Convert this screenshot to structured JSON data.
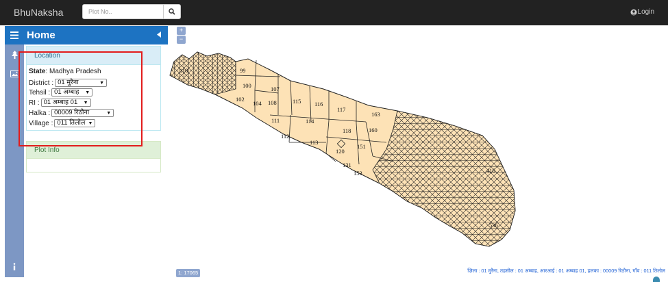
{
  "navbar": {
    "brand": "BhuNaksha",
    "search_placeholder": "Plot No..",
    "login_label": "Login"
  },
  "panel": {
    "title": "Home",
    "location": {
      "header": "Location",
      "state_label": "State",
      "state_value": ": Madhya Pradesh",
      "fields": [
        {
          "label": "District :",
          "value": "01 मुरैना"
        },
        {
          "label": "Tehsil :",
          "value": "01 अम्बाह"
        },
        {
          "label": "RI :",
          "value": "01 अम्बाह 01"
        },
        {
          "label": "Halka :",
          "value": "00009 रिठौना"
        },
        {
          "label": "Village :",
          "value": "011 तिलोल"
        }
      ]
    },
    "plot_info": {
      "header": "Plot Info"
    }
  },
  "map": {
    "zoom_in": "+",
    "zoom_out": "−",
    "scale": "1: 17065",
    "plot_labels": [
      "99",
      "100",
      "107",
      "102",
      "104",
      "108",
      "115",
      "116",
      "117",
      "163",
      "111",
      "114",
      "118",
      "160",
      "112",
      "113",
      "151",
      "120",
      "131",
      "153",
      "110",
      "416",
      "536"
    ],
    "footer": "ज़िला : 01 मुरैना, तहसील : 01 अम्बाह, आरआई : 01 अम्बाह 01, हलका : 00009 रिठौना, गाँव : 011 तिलोल"
  },
  "colors": {
    "navbar": "#222222",
    "primary": "#1d73c2",
    "strip": "#7d97c4",
    "parcel_fill": "#fde2b6",
    "highlight": "#e21b1b"
  },
  "icons": [
    "search-icon",
    "user-icon",
    "menu-icon",
    "tree-icon",
    "image-icon",
    "info-icon",
    "collapse-left-icon"
  ]
}
